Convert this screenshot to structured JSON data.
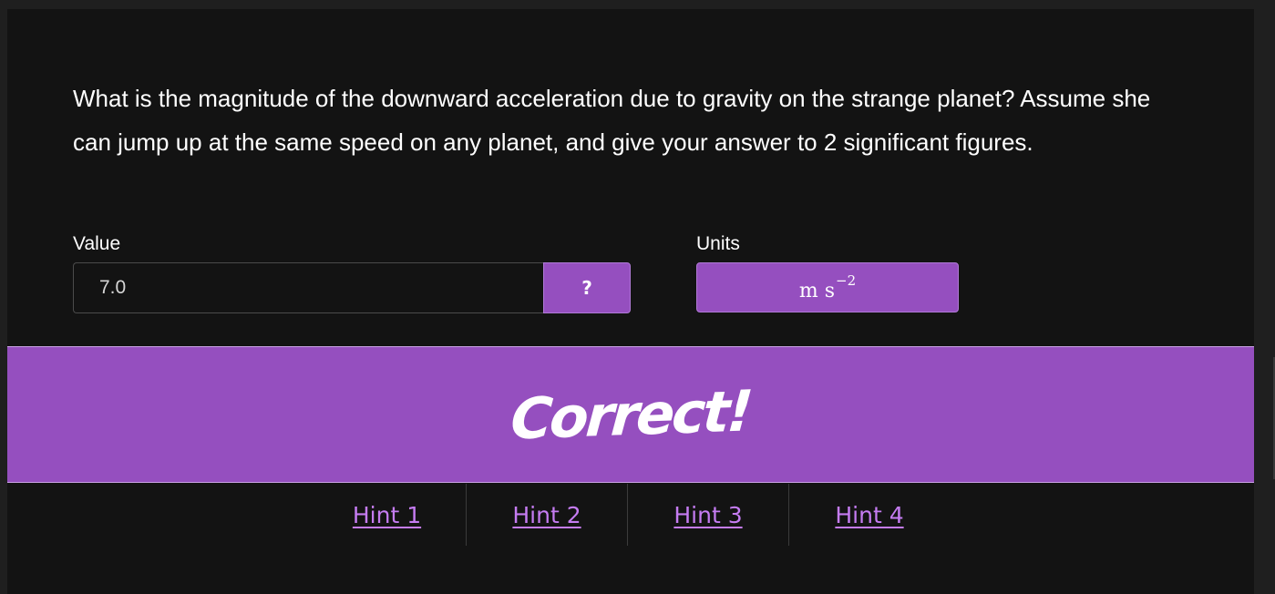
{
  "question": {
    "text": "What is the magnitude of the downward acceleration due to gravity on the strange planet? Assume she can jump up at the same speed on any planet, and give your answer to 2 significant figures."
  },
  "answer": {
    "value_label": "Value",
    "value": "7.0",
    "help_label": "?",
    "units_label": "Units",
    "units_base": "m s",
    "units_exponent": "−2"
  },
  "feedback": {
    "message": "Correct!"
  },
  "hints": [
    {
      "label": "Hint 1"
    },
    {
      "label": "Hint 2"
    },
    {
      "label": "Hint 3"
    },
    {
      "label": "Hint 4"
    }
  ],
  "colors": {
    "accent": "#954fbf",
    "link": "#c57cf2",
    "background": "#131313"
  }
}
